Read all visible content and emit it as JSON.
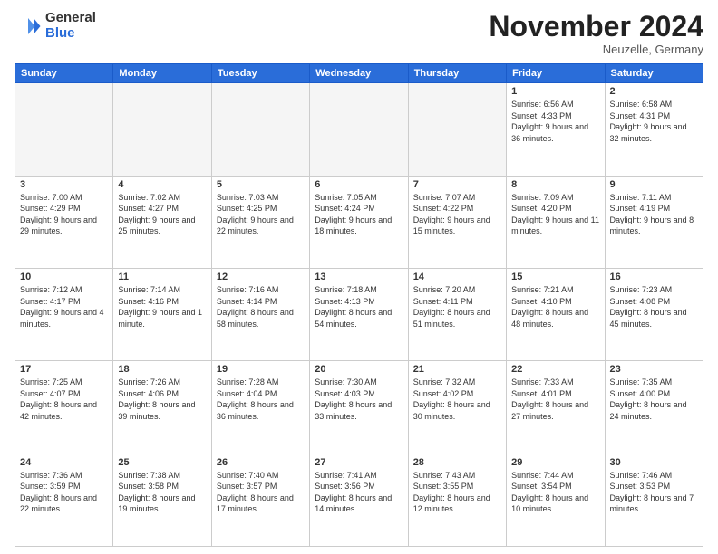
{
  "logo": {
    "general": "General",
    "blue": "Blue"
  },
  "title": "November 2024",
  "location": "Neuzelle, Germany",
  "weekdays": [
    "Sunday",
    "Monday",
    "Tuesday",
    "Wednesday",
    "Thursday",
    "Friday",
    "Saturday"
  ],
  "weeks": [
    [
      {
        "day": "",
        "info": ""
      },
      {
        "day": "",
        "info": ""
      },
      {
        "day": "",
        "info": ""
      },
      {
        "day": "",
        "info": ""
      },
      {
        "day": "",
        "info": ""
      },
      {
        "day": "1",
        "info": "Sunrise: 6:56 AM\nSunset: 4:33 PM\nDaylight: 9 hours\nand 36 minutes."
      },
      {
        "day": "2",
        "info": "Sunrise: 6:58 AM\nSunset: 4:31 PM\nDaylight: 9 hours\nand 32 minutes."
      }
    ],
    [
      {
        "day": "3",
        "info": "Sunrise: 7:00 AM\nSunset: 4:29 PM\nDaylight: 9 hours\nand 29 minutes."
      },
      {
        "day": "4",
        "info": "Sunrise: 7:02 AM\nSunset: 4:27 PM\nDaylight: 9 hours\nand 25 minutes."
      },
      {
        "day": "5",
        "info": "Sunrise: 7:03 AM\nSunset: 4:25 PM\nDaylight: 9 hours\nand 22 minutes."
      },
      {
        "day": "6",
        "info": "Sunrise: 7:05 AM\nSunset: 4:24 PM\nDaylight: 9 hours\nand 18 minutes."
      },
      {
        "day": "7",
        "info": "Sunrise: 7:07 AM\nSunset: 4:22 PM\nDaylight: 9 hours\nand 15 minutes."
      },
      {
        "day": "8",
        "info": "Sunrise: 7:09 AM\nSunset: 4:20 PM\nDaylight: 9 hours\nand 11 minutes."
      },
      {
        "day": "9",
        "info": "Sunrise: 7:11 AM\nSunset: 4:19 PM\nDaylight: 9 hours\nand 8 minutes."
      }
    ],
    [
      {
        "day": "10",
        "info": "Sunrise: 7:12 AM\nSunset: 4:17 PM\nDaylight: 9 hours\nand 4 minutes."
      },
      {
        "day": "11",
        "info": "Sunrise: 7:14 AM\nSunset: 4:16 PM\nDaylight: 9 hours\nand 1 minute."
      },
      {
        "day": "12",
        "info": "Sunrise: 7:16 AM\nSunset: 4:14 PM\nDaylight: 8 hours\nand 58 minutes."
      },
      {
        "day": "13",
        "info": "Sunrise: 7:18 AM\nSunset: 4:13 PM\nDaylight: 8 hours\nand 54 minutes."
      },
      {
        "day": "14",
        "info": "Sunrise: 7:20 AM\nSunset: 4:11 PM\nDaylight: 8 hours\nand 51 minutes."
      },
      {
        "day": "15",
        "info": "Sunrise: 7:21 AM\nSunset: 4:10 PM\nDaylight: 8 hours\nand 48 minutes."
      },
      {
        "day": "16",
        "info": "Sunrise: 7:23 AM\nSunset: 4:08 PM\nDaylight: 8 hours\nand 45 minutes."
      }
    ],
    [
      {
        "day": "17",
        "info": "Sunrise: 7:25 AM\nSunset: 4:07 PM\nDaylight: 8 hours\nand 42 minutes."
      },
      {
        "day": "18",
        "info": "Sunrise: 7:26 AM\nSunset: 4:06 PM\nDaylight: 8 hours\nand 39 minutes."
      },
      {
        "day": "19",
        "info": "Sunrise: 7:28 AM\nSunset: 4:04 PM\nDaylight: 8 hours\nand 36 minutes."
      },
      {
        "day": "20",
        "info": "Sunrise: 7:30 AM\nSunset: 4:03 PM\nDaylight: 8 hours\nand 33 minutes."
      },
      {
        "day": "21",
        "info": "Sunrise: 7:32 AM\nSunset: 4:02 PM\nDaylight: 8 hours\nand 30 minutes."
      },
      {
        "day": "22",
        "info": "Sunrise: 7:33 AM\nSunset: 4:01 PM\nDaylight: 8 hours\nand 27 minutes."
      },
      {
        "day": "23",
        "info": "Sunrise: 7:35 AM\nSunset: 4:00 PM\nDaylight: 8 hours\nand 24 minutes."
      }
    ],
    [
      {
        "day": "24",
        "info": "Sunrise: 7:36 AM\nSunset: 3:59 PM\nDaylight: 8 hours\nand 22 minutes."
      },
      {
        "day": "25",
        "info": "Sunrise: 7:38 AM\nSunset: 3:58 PM\nDaylight: 8 hours\nand 19 minutes."
      },
      {
        "day": "26",
        "info": "Sunrise: 7:40 AM\nSunset: 3:57 PM\nDaylight: 8 hours\nand 17 minutes."
      },
      {
        "day": "27",
        "info": "Sunrise: 7:41 AM\nSunset: 3:56 PM\nDaylight: 8 hours\nand 14 minutes."
      },
      {
        "day": "28",
        "info": "Sunrise: 7:43 AM\nSunset: 3:55 PM\nDaylight: 8 hours\nand 12 minutes."
      },
      {
        "day": "29",
        "info": "Sunrise: 7:44 AM\nSunset: 3:54 PM\nDaylight: 8 hours\nand 10 minutes."
      },
      {
        "day": "30",
        "info": "Sunrise: 7:46 AM\nSunset: 3:53 PM\nDaylight: 8 hours\nand 7 minutes."
      }
    ]
  ]
}
